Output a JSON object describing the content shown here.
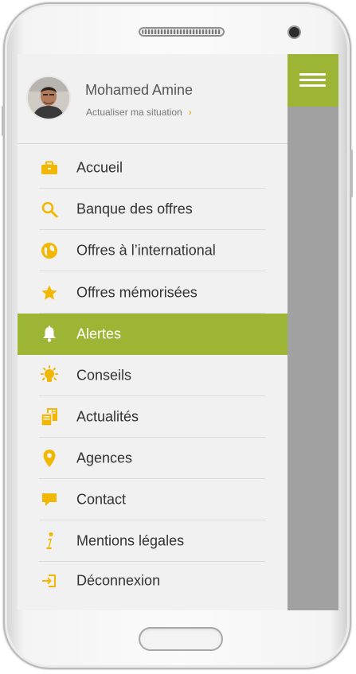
{
  "colors": {
    "accent": "#9db534",
    "icon": "#f2b700",
    "drawer_bg": "#f1f1f1",
    "overlay": "#a1a1a1"
  },
  "profile": {
    "name": "Mohamed Amine",
    "subtitle": "Actualiser ma situation",
    "chevron": "›"
  },
  "menu": [
    {
      "label": "Accueil",
      "icon": "briefcase-icon",
      "active": false
    },
    {
      "label": "Banque des offres",
      "icon": "search-icon",
      "active": false
    },
    {
      "label": "Offres à l’international",
      "icon": "globe-icon",
      "active": false
    },
    {
      "label": "Offres mémorisées",
      "icon": "star-icon",
      "active": false
    },
    {
      "label": "Alertes",
      "icon": "bell-icon",
      "active": true
    },
    {
      "label": "Conseils",
      "icon": "lightbulb-icon",
      "active": false
    },
    {
      "label": "Actualités",
      "icon": "news-icon",
      "active": false
    },
    {
      "label": "Agences",
      "icon": "map-pin-icon",
      "active": false
    },
    {
      "label": "Contact",
      "icon": "chat-icon",
      "active": false
    },
    {
      "label": "Mentions légales",
      "icon": "info-icon",
      "active": false
    },
    {
      "label": "Déconnexion",
      "icon": "logout-icon",
      "active": false
    }
  ]
}
